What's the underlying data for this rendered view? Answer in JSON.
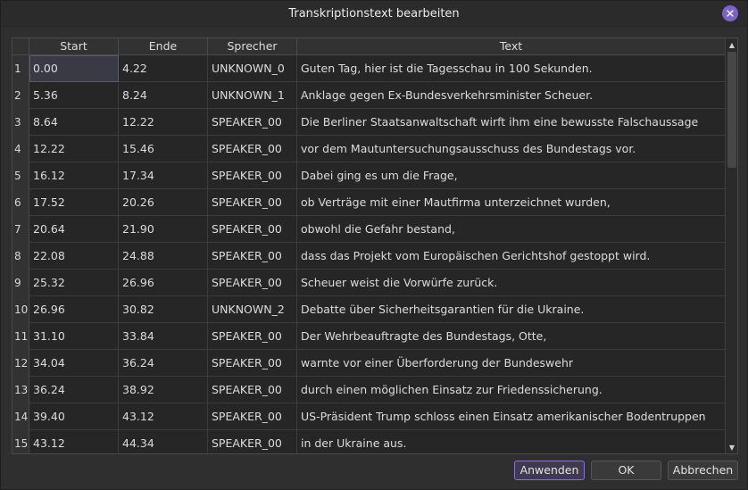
{
  "window": {
    "title": "Transkriptionstext bearbeiten"
  },
  "table": {
    "columns": [
      "Start",
      "Ende",
      "Sprecher",
      "Text"
    ],
    "rows": [
      {
        "num": "1",
        "start": "0.00",
        "end": "4.22",
        "speaker": "UNKNOWN_0",
        "text": "Guten Tag, hier ist die Tagesschau in 100 Sekunden."
      },
      {
        "num": "2",
        "start": "5.36",
        "end": "8.24",
        "speaker": "UNKNOWN_1",
        "text": "Anklage gegen Ex-Bundesverkehrsminister Scheuer."
      },
      {
        "num": "3",
        "start": "8.64",
        "end": "12.22",
        "speaker": "SPEAKER_00",
        "text": "Die Berliner Staatsanwaltschaft wirft ihm eine bewusste Falschaussage"
      },
      {
        "num": "4",
        "start": "12.22",
        "end": "15.46",
        "speaker": "SPEAKER_00",
        "text": "vor dem Mautuntersuchungsausschuss des Bundestags vor."
      },
      {
        "num": "5",
        "start": "16.12",
        "end": "17.34",
        "speaker": "SPEAKER_00",
        "text": "Dabei ging es um die Frage,"
      },
      {
        "num": "6",
        "start": "17.52",
        "end": "20.26",
        "speaker": "SPEAKER_00",
        "text": "ob Verträge mit einer Mautfirma unterzeichnet wurden,"
      },
      {
        "num": "7",
        "start": "20.64",
        "end": "21.90",
        "speaker": "SPEAKER_00",
        "text": "obwohl die Gefahr bestand,"
      },
      {
        "num": "8",
        "start": "22.08",
        "end": "24.88",
        "speaker": "SPEAKER_00",
        "text": "dass das Projekt vom Europäischen Gerichtshof gestoppt wird."
      },
      {
        "num": "9",
        "start": "25.32",
        "end": "26.96",
        "speaker": "SPEAKER_00",
        "text": "Scheuer weist die Vorwürfe zurück."
      },
      {
        "num": "10",
        "start": "26.96",
        "end": "30.82",
        "speaker": "UNKNOWN_2",
        "text": "Debatte über Sicherheitsgarantien für die Ukraine."
      },
      {
        "num": "11",
        "start": "31.10",
        "end": "33.84",
        "speaker": "SPEAKER_00",
        "text": "Der Wehrbeauftragte des Bundestags, Otte,"
      },
      {
        "num": "12",
        "start": "34.04",
        "end": "36.24",
        "speaker": "SPEAKER_00",
        "text": "warnte vor einer Überforderung der Bundeswehr"
      },
      {
        "num": "13",
        "start": "36.24",
        "end": "38.92",
        "speaker": "SPEAKER_00",
        "text": "durch einen möglichen Einsatz zur Friedenssicherung."
      },
      {
        "num": "14",
        "start": "39.40",
        "end": "43.12",
        "speaker": "SPEAKER_00",
        "text": "US-Präsident Trump schloss einen Einsatz amerikanischer Bodentruppen"
      },
      {
        "num": "15",
        "start": "43.12",
        "end": "44.34",
        "speaker": "SPEAKER_00",
        "text": "in der Ukraine aus."
      }
    ]
  },
  "buttons": {
    "apply": "Anwenden",
    "ok": "OK",
    "cancel": "Abbrechen"
  },
  "icons": {
    "close": "close-icon",
    "scroll_up": "arrow-up-icon",
    "scroll_down": "arrow-down-icon"
  },
  "colors": {
    "accent": "#7b63c9",
    "background": "#2f2f2f"
  }
}
